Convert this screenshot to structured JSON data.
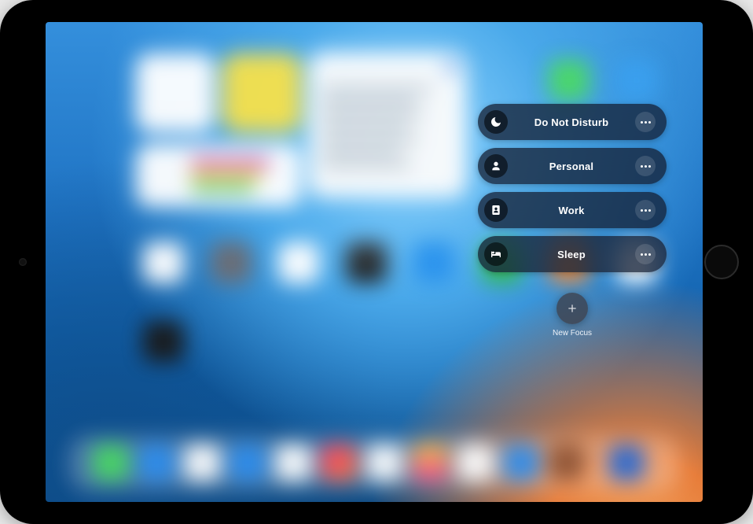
{
  "focus_panel": {
    "items": [
      {
        "label": "Do Not Disturb",
        "icon": "moon"
      },
      {
        "label": "Personal",
        "icon": "person"
      },
      {
        "label": "Work",
        "icon": "badge"
      },
      {
        "label": "Sleep",
        "icon": "bed"
      }
    ],
    "new_focus_label": "New Focus"
  },
  "colors": {
    "pill_bg": "rgba(20,30,50,0.75)",
    "accent": "#2f7ee6"
  }
}
